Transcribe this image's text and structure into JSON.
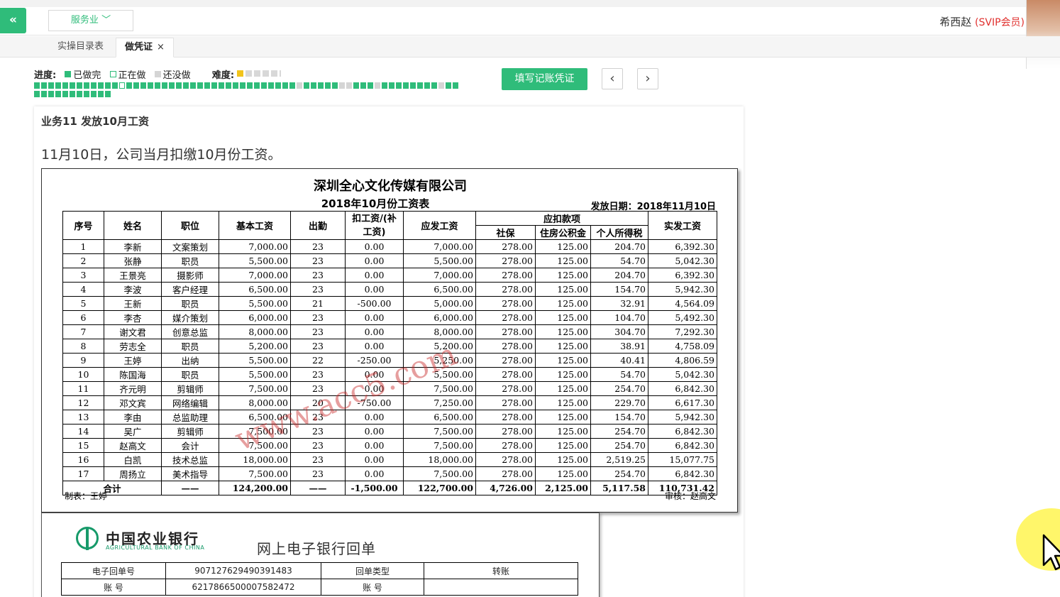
{
  "topbar": {
    "collapse_icon": "«",
    "industry": "服务业",
    "user_name": "希西赵",
    "user_tag": "(SVIP会员)"
  },
  "tabs": [
    {
      "label": "实操目录表"
    },
    {
      "label": "做凭证",
      "close": "×"
    }
  ],
  "progress": {
    "label": "进度:",
    "done": "已做完",
    "doing": "正在做",
    "todo": "还没做",
    "difficulty_label": "难度:",
    "difficulty_stars": 1,
    "difficulty_max": 5,
    "colors": {
      "done": "#2fbc7a",
      "todo": "#d5d5d5"
    }
  },
  "actions": {
    "fill_voucher": "填写记账凭证",
    "prev": "‹",
    "next": "›"
  },
  "business": {
    "title": "业务11 发放10月工资",
    "description": "11月10日，公司当月扣缴10月份工资。"
  },
  "salary_sheet": {
    "company": "深圳全心文化传媒有限公司",
    "subtitle": "2018年10月份工资表",
    "date": "发放日期：2018年11月10日",
    "headers": {
      "no": "序号",
      "name": "姓名",
      "position": "职位",
      "base": "基本工资",
      "attendance": "出勤",
      "deduct": "扣工资/(补工资)",
      "payable": "应发工资",
      "deductions": "应扣款项",
      "social": "社保",
      "fund": "住房公积金",
      "tax": "个人所得税",
      "net": "实发工资"
    },
    "rows": [
      [
        "1",
        "李新",
        "文案策划",
        "7,000.00",
        "23",
        "0.00",
        "7,000.00",
        "278.00",
        "125.00",
        "204.70",
        "6,392.30"
      ],
      [
        "2",
        "张静",
        "职员",
        "5,500.00",
        "23",
        "0.00",
        "5,500.00",
        "278.00",
        "125.00",
        "54.70",
        "5,042.30"
      ],
      [
        "3",
        "王景亮",
        "摄影师",
        "7,000.00",
        "23",
        "0.00",
        "7,000.00",
        "278.00",
        "125.00",
        "204.70",
        "6,392.30"
      ],
      [
        "4",
        "李波",
        "客户经理",
        "6,500.00",
        "23",
        "0.00",
        "6,500.00",
        "278.00",
        "125.00",
        "154.70",
        "5,942.30"
      ],
      [
        "5",
        "王新",
        "职员",
        "5,500.00",
        "21",
        "-500.00",
        "5,000.00",
        "278.00",
        "125.00",
        "32.91",
        "4,564.09"
      ],
      [
        "6",
        "李杏",
        "媒介策划",
        "6,000.00",
        "23",
        "0.00",
        "6,000.00",
        "278.00",
        "125.00",
        "104.70",
        "5,492.30"
      ],
      [
        "7",
        "谢文君",
        "创意总监",
        "8,000.00",
        "23",
        "0.00",
        "8,000.00",
        "278.00",
        "125.00",
        "304.70",
        "7,292.30"
      ],
      [
        "8",
        "劳志全",
        "职员",
        "5,200.00",
        "23",
        "0.00",
        "5,200.00",
        "278.00",
        "125.00",
        "38.91",
        "4,758.09"
      ],
      [
        "9",
        "王婷",
        "出纳",
        "5,500.00",
        "22",
        "-250.00",
        "5,250.00",
        "278.00",
        "125.00",
        "40.41",
        "4,806.59"
      ],
      [
        "10",
        "陈国海",
        "职员",
        "5,500.00",
        "23",
        "0.00",
        "5,500.00",
        "278.00",
        "125.00",
        "54.70",
        "5,042.30"
      ],
      [
        "11",
        "齐元明",
        "剪辑师",
        "7,500.00",
        "23",
        "0.00",
        "7,500.00",
        "278.00",
        "125.00",
        "254.70",
        "6,842.30"
      ],
      [
        "12",
        "邓文宾",
        "网络编辑",
        "8,000.00",
        "20",
        "-750.00",
        "7,250.00",
        "278.00",
        "125.00",
        "229.70",
        "6,617.30"
      ],
      [
        "13",
        "李由",
        "总监助理",
        "6,500.00",
        "23",
        "0.00",
        "6,500.00",
        "278.00",
        "125.00",
        "154.70",
        "5,942.30"
      ],
      [
        "14",
        "吴广",
        "剪辑师",
        "7,500.00",
        "23",
        "0.00",
        "7,500.00",
        "278.00",
        "125.00",
        "254.70",
        "6,842.30"
      ],
      [
        "15",
        "赵高文",
        "会计",
        "7,500.00",
        "23",
        "0.00",
        "7,500.00",
        "278.00",
        "125.00",
        "254.70",
        "6,842.30"
      ],
      [
        "16",
        "白凯",
        "技术总监",
        "18,000.00",
        "23",
        "0.00",
        "18,000.00",
        "278.00",
        "125.00",
        "2,519.25",
        "15,077.75"
      ],
      [
        "17",
        "周扬立",
        "美术指导",
        "7,500.00",
        "23",
        "0.00",
        "7,500.00",
        "278.00",
        "125.00",
        "254.70",
        "6,842.30"
      ]
    ],
    "total": [
      "合计",
      "——",
      "124,200.00",
      "——",
      "-1,500.00",
      "122,700.00",
      "4,726.00",
      "2,125.00",
      "5,117.58",
      "110,731.42"
    ],
    "maker": "制表：王婷",
    "checker": "审核：赵高文",
    "watermark": "www.acc5.com"
  },
  "receipt": {
    "bank_cn": "中国农业银行",
    "bank_en": "AGRICULTURAL BANK OF CHINA",
    "title": "网上电子银行回单",
    "row1": {
      "label1": "电子回单号",
      "value1": "907127629490391483",
      "label2": "回单类型",
      "value2": "转账"
    },
    "row2": {
      "label1": "账 号",
      "value1": "6217866500007582472",
      "label2": "账 号",
      "value2": ""
    }
  }
}
